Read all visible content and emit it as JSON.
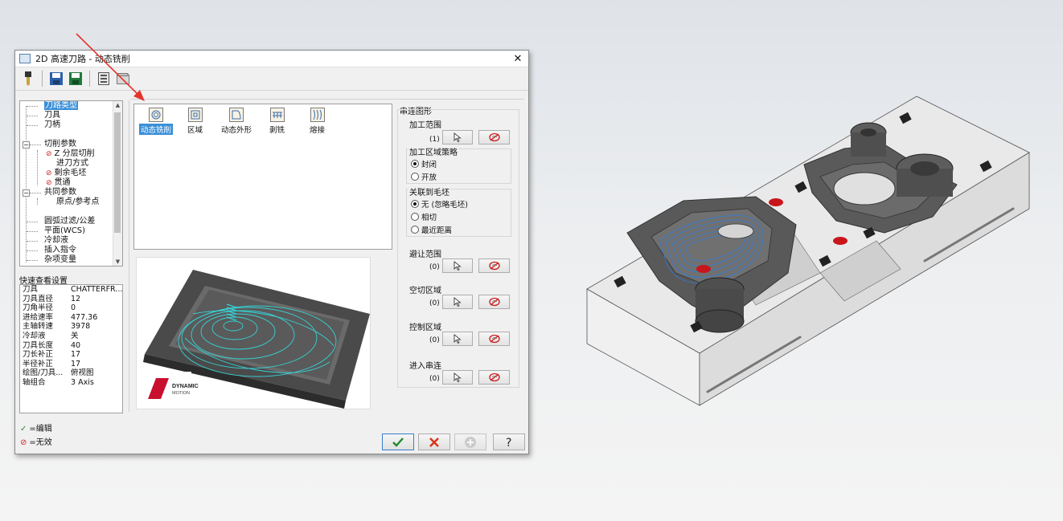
{
  "dialog": {
    "title": "2D 高速刀路 - 动态铣削",
    "close_glyph": "✕"
  },
  "toolbar": {
    "icons": [
      "tool-icon",
      "save-icon",
      "save-as-icon",
      "calculator-icon",
      "database-icon"
    ]
  },
  "tree": {
    "items": [
      {
        "label": "刀路类型",
        "selected": true,
        "level": 1
      },
      {
        "label": "刀具",
        "level": 1
      },
      {
        "label": "刀柄",
        "level": 1
      },
      {
        "label": "切削参数",
        "level": 1,
        "expandable": true
      },
      {
        "label": "Z 分层切削",
        "level": 2,
        "invalid": true
      },
      {
        "label": "进刀方式",
        "level": 2
      },
      {
        "label": "剩余毛坯",
        "level": 2,
        "invalid": true
      },
      {
        "label": "贯通",
        "level": 2,
        "invalid": true
      },
      {
        "label": "共同参数",
        "level": 1,
        "expandable": true
      },
      {
        "label": "原点/参考点",
        "level": 2
      },
      {
        "label": "圆弧过滤/公差",
        "level": 1
      },
      {
        "label": "平面(WCS)",
        "level": 1
      },
      {
        "label": "冷却液",
        "level": 1
      },
      {
        "label": "插入指令",
        "level": 1
      },
      {
        "label": "杂项变量",
        "level": 1
      }
    ]
  },
  "quick_view": {
    "label": "快速查看设置",
    "rows": [
      {
        "k": "刀具",
        "v": "CHATTERFR..."
      },
      {
        "k": "刀具直径",
        "v": "12"
      },
      {
        "k": "刀角半径",
        "v": "0"
      },
      {
        "k": "进给速率",
        "v": "477.36"
      },
      {
        "k": "主轴转速",
        "v": "3978"
      },
      {
        "k": "冷却液",
        "v": "关"
      },
      {
        "k": "刀具长度",
        "v": "40"
      },
      {
        "k": "刀长补正",
        "v": "17"
      },
      {
        "k": "半径补正",
        "v": "17"
      },
      {
        "k": "绘图/刀具...",
        "v": "俯视图"
      },
      {
        "k": "轴组合",
        "v": "3 Axis"
      }
    ]
  },
  "legend": {
    "edit": "=编辑",
    "invalid": "=无效"
  },
  "toolpath_types": [
    {
      "label": "动态铣削",
      "active": true
    },
    {
      "label": "区域"
    },
    {
      "label": "动态外形"
    },
    {
      "label": "剥铣"
    },
    {
      "label": "熔接"
    }
  ],
  "preview": {
    "brand_line1": "DYNAMIC",
    "brand_line2": "MOTION"
  },
  "chain": {
    "header": "串连图形",
    "machining_range": {
      "label": "加工范围",
      "count": "(1)"
    },
    "strategy": {
      "label": "加工区域策略",
      "options": [
        "封闭",
        "开放"
      ],
      "selected": 0
    },
    "stock": {
      "label": "关联到毛坯",
      "options": [
        "无 (忽略毛坯)",
        "相切",
        "最近距离"
      ],
      "selected": 0
    },
    "avoid": {
      "label": "避让范围",
      "count": "(0)"
    },
    "air": {
      "label": "空切区域",
      "count": "(0)"
    },
    "control": {
      "label": "控制区域",
      "count": "(0)"
    },
    "entry": {
      "label": "进入串连",
      "count": "(0)"
    }
  },
  "colors": {
    "accent": "#3a8fd8",
    "invalid_red": "#d02020",
    "ok_green": "#2a8a2a",
    "toolpath_cyan": "#36d2d6",
    "model_gray": "#595959"
  }
}
